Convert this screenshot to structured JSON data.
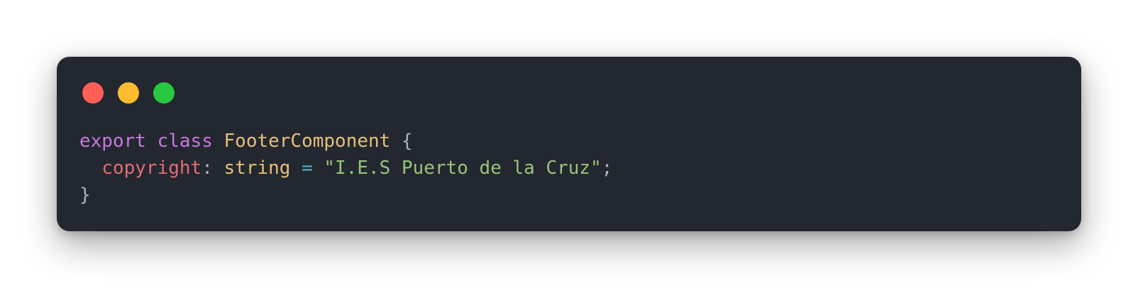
{
  "window": {
    "traffic_lights": [
      {
        "name": "close",
        "color": "#ff5f57"
      },
      {
        "name": "minimize",
        "color": "#febc2e"
      },
      {
        "name": "zoom",
        "color": "#28c840"
      }
    ]
  },
  "code": {
    "line1": {
      "kw1": "export",
      "kw2": "class",
      "class_name": "FooterComponent",
      "brace_open": "{"
    },
    "line2": {
      "indent": "  ",
      "prop": "copyright",
      "colon": ":",
      "type": "string",
      "eq": "=",
      "string": "\"I.E.S Puerto de la Cruz\"",
      "semi": ";"
    },
    "line3": {
      "brace_close": "}"
    }
  },
  "colors": {
    "background": "#23272f",
    "keyword": "#c678dd",
    "class": "#e5c07b",
    "property": "#e06c75",
    "operator": "#56b6c2",
    "string": "#98c379",
    "punctuation": "#abb2bf"
  }
}
